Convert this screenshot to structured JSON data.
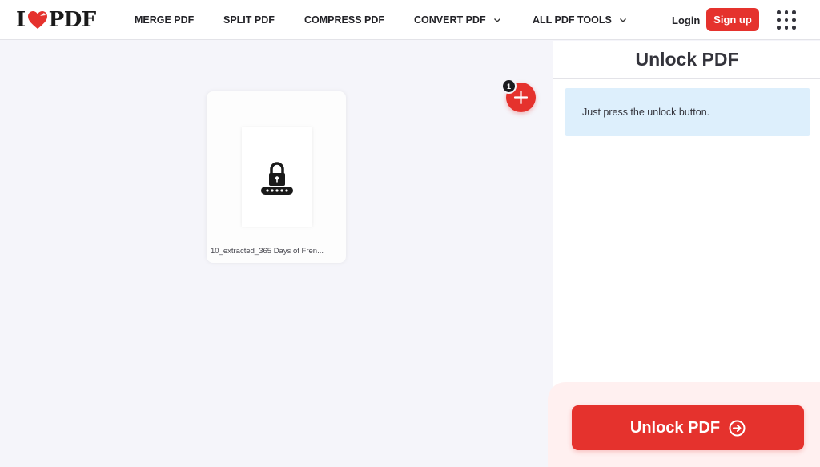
{
  "header": {
    "logo": {
      "left": "I",
      "heart_icon": "heart-icon",
      "right": "PDF"
    },
    "nav": [
      {
        "label": "MERGE PDF"
      },
      {
        "label": "SPLIT PDF"
      },
      {
        "label": "COMPRESS PDF"
      },
      {
        "label": "CONVERT PDF",
        "has_dropdown": true
      },
      {
        "label": "ALL PDF TOOLS",
        "has_dropdown": true
      }
    ],
    "login_label": "Login",
    "signup_label": "Sign up",
    "apps_icon": "grid-menu-icon"
  },
  "workspace": {
    "file": {
      "name": "10_extracted_365 Days of Fren...",
      "icon": "locked-file-icon"
    },
    "add_button_icon": "plus-icon",
    "file_count": "1"
  },
  "sidebar": {
    "title": "Unlock PDF",
    "info_text": "Just press the unlock button.",
    "action_label": "Unlock PDF",
    "action_icon": "arrow-right-circle-icon"
  },
  "colors": {
    "accent": "#e5322d",
    "info_bg": "#ddeffc",
    "workspace_bg": "#f5f5fa",
    "action_area_bg": "#fff0f0"
  }
}
